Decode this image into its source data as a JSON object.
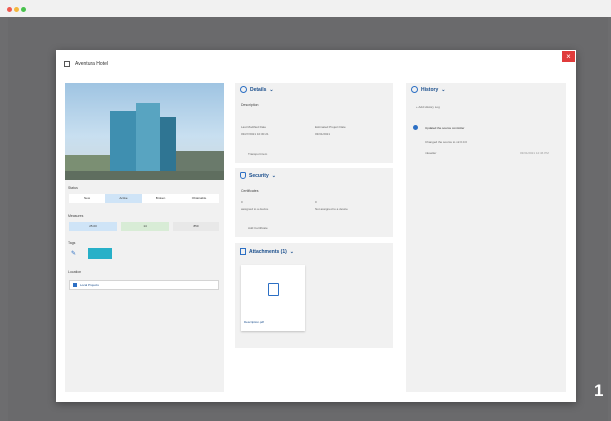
{
  "window": {
    "title": "Aventura Hotel",
    "close_label": "×"
  },
  "left": {
    "status": {
      "label": "Status",
      "options": [
        "New",
        "Active",
        "Broken",
        "Obtainable"
      ]
    },
    "counts": {
      "label": "Measures",
      "items": [
        {
          "label": "25.00"
        },
        {
          "label": "14"
        },
        {
          "label": "850"
        }
      ]
    },
    "tags": {
      "label": "Tags"
    },
    "location": {
      "label": "Location",
      "value": "Local Projects"
    }
  },
  "details": {
    "title": "Details",
    "section": "Description",
    "fields": [
      {
        "label": "Last Modified Date",
        "value": "03/27/2021 10:30:21"
      },
      {
        "label": "Estimated Project Date",
        "value": "03/31/2021"
      }
    ],
    "action": "Transport item"
  },
  "security": {
    "title": "Security",
    "section": "Certificates",
    "a": {
      "count": "0",
      "caption": "assigned to a device"
    },
    "b": {
      "count": "0",
      "caption": "Not assigned to a device"
    },
    "action": "Add Certificate"
  },
  "attachments": {
    "title": "Attachments (1)",
    "file": "Description.pdf"
  },
  "history": {
    "title": "History",
    "add_label": "Add History Log",
    "entry": {
      "title": "Updated the source controller",
      "line": "Changed the source to v2.0.0.0",
      "user": "mkoeller",
      "time": "03/31/2021 12:46 PM"
    }
  },
  "badge": "1"
}
